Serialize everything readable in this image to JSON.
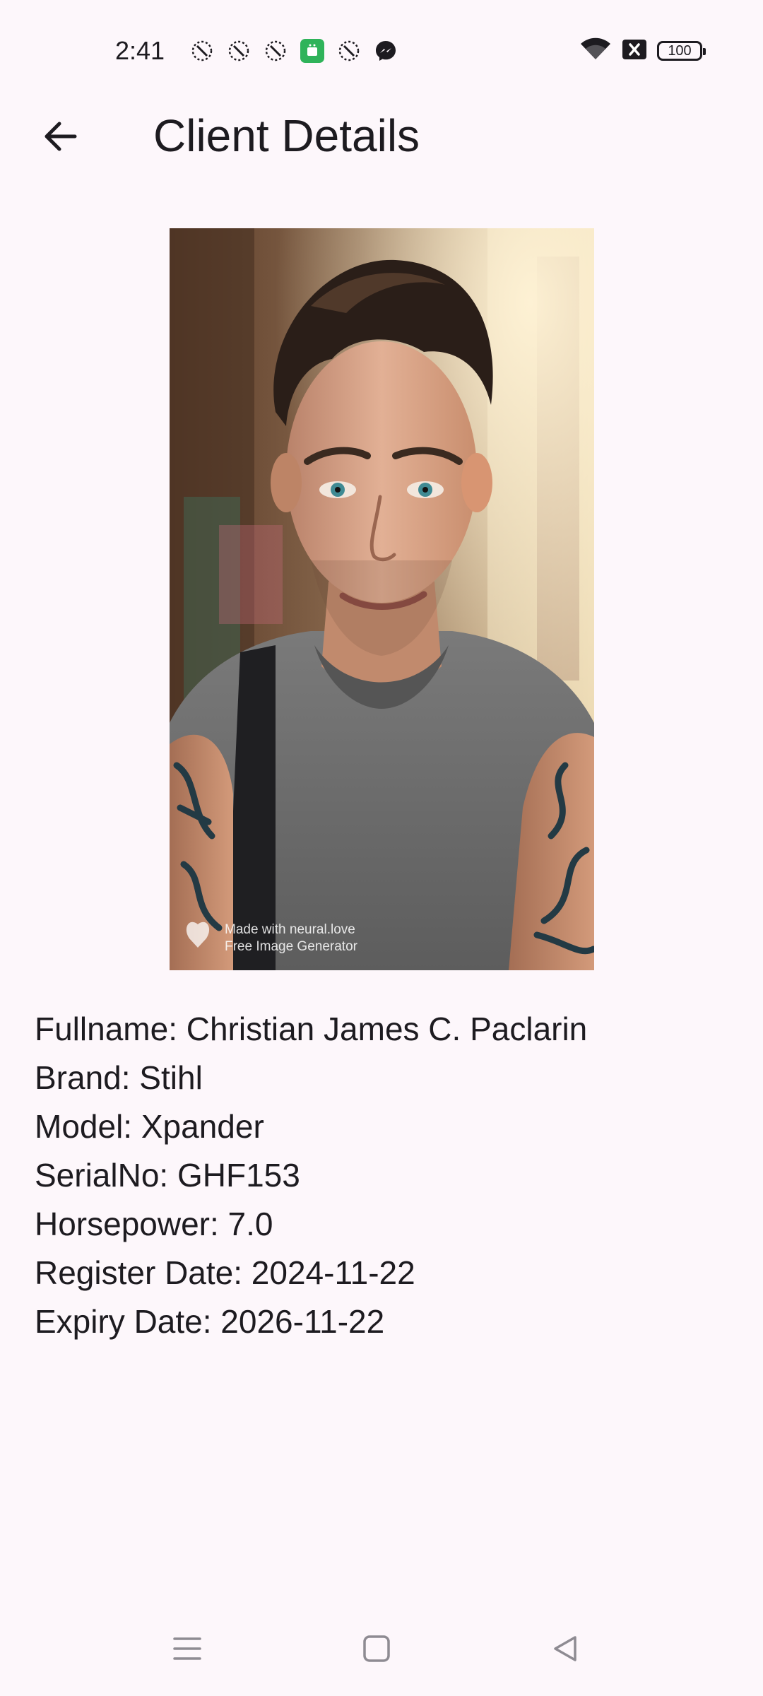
{
  "status_bar": {
    "time": "2:41",
    "battery_level": "100",
    "notification_icons": [
      "satellite-icon",
      "satellite-icon",
      "satellite-icon",
      "android-app-icon",
      "satellite-icon",
      "messenger-icon"
    ],
    "system_icons": [
      "wifi-icon",
      "no-signal-icon",
      "battery-icon"
    ]
  },
  "app_bar": {
    "title": "Client Details",
    "back_icon": "arrow-back-icon"
  },
  "photo": {
    "watermark_line1": "Made with neural.love",
    "watermark_line2": "Free Image Generator"
  },
  "details": {
    "fullname": "Fullname: Christian James C. Paclarin",
    "brand": "Brand: Stihl",
    "model": "Model: Xpander",
    "serial": "SerialNo: GHF153",
    "horsepower": "Horsepower: 7.0",
    "register_date": "Register Date: 2024-11-22",
    "expiry_date": "Expiry Date: 2026-11-22"
  },
  "nav_bar": {
    "icons": [
      "menu-icon",
      "home-icon",
      "back-icon"
    ]
  },
  "colors": {
    "background": "#fdf7fb",
    "text": "#1d1b20",
    "notification_green": "#2fb35a"
  }
}
